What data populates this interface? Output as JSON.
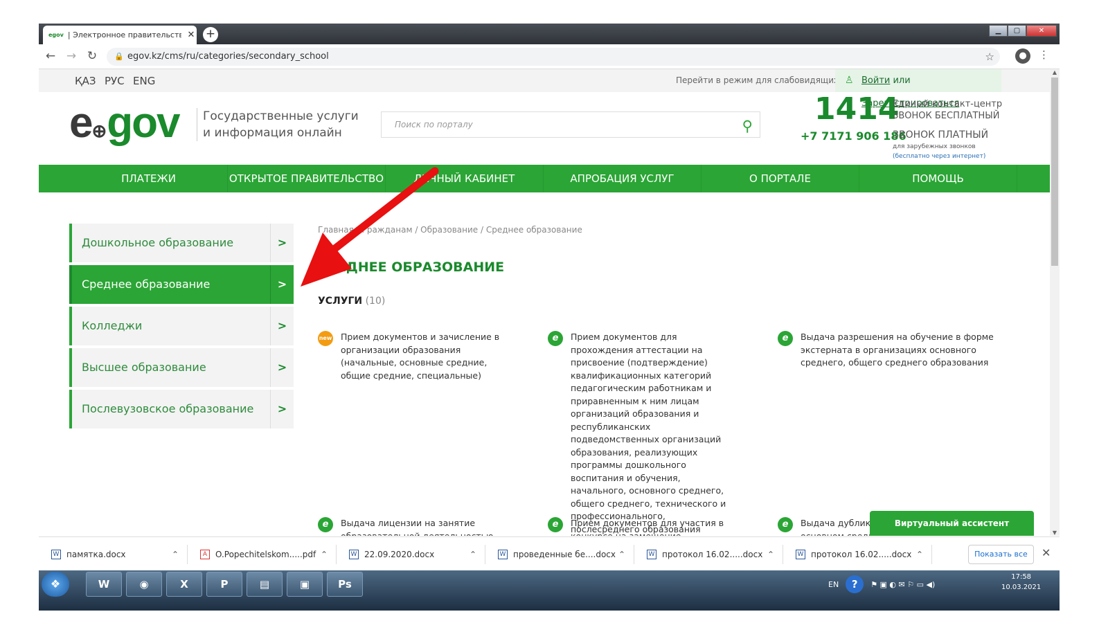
{
  "browser": {
    "tab": {
      "favicon": "egov",
      "title": "| Электронное правительство Р",
      "close": "✕"
    },
    "new_tab": "+",
    "url": "egov.kz/cms/ru/categories/secondary_school"
  },
  "top": {
    "languages": [
      "ҚАЗ",
      "РУС",
      "ENG"
    ],
    "impaired_mode": "Перейти в режим для слабовидящих",
    "login": {
      "login": "Войти",
      "or": " или ",
      "register": "Зарегистрироваться"
    }
  },
  "header": {
    "logo": {
      "e": "e",
      "dot": "⊕",
      "gov": "gov"
    },
    "slogan": [
      "Государственные услуги",
      "и информация онлайн"
    ],
    "search_placeholder": "Поиск по порталу",
    "contact": {
      "number": "1414",
      "center": "Единый контакт-центр",
      "free": "ЗВОНОК БЕСПЛАТНЫЙ",
      "phone": "+7 7171 906 186",
      "paid": "ЗВОНОК ПЛАТНЫЙ",
      "foreign": "для зарубежных звонков",
      "internet": "(бесплатно через интернет)"
    }
  },
  "menu": [
    "ПЛАТЕЖИ",
    "ОТКРЫТОЕ ПРАВИТЕЛЬСТВО",
    "ЛИЧНЫЙ КАБИНЕТ",
    "АПРОБАЦИЯ УСЛУГ",
    "О ПОРТАЛЕ",
    "ПОМОЩЬ"
  ],
  "sidebar": [
    {
      "label": "Дошкольное образование"
    },
    {
      "label": "Среднее образование"
    },
    {
      "label": "Колледжи"
    },
    {
      "label": "Высшее образование"
    },
    {
      "label": "Послевузовское образование"
    }
  ],
  "main": {
    "breadcrumb": "Главная / Гражданам / Образование / Среднее образование",
    "title": "СРЕДНЕЕ ОБРАЗОВАНИЕ",
    "services_label": "УСЛУГИ",
    "services_count": "(10)",
    "services": [
      {
        "icon": "new",
        "text": "Прием документов и зачисление в организации образования (начальные, основные средние, общие средние, специальные)"
      },
      {
        "icon": "e",
        "text": "Прием документов для прохождения аттестации на присвоение (подтверждение) квалификационных категорий педагогическим работникам и приравненным к ним лицам организаций образования и республиканских подведомственных организаций образования, реализующих программы дошкольного воспитания и обучения, начального, основного среднего, общего среднего, технического и профессионального, послесреднего образования"
      },
      {
        "icon": "e",
        "text": "Выдача разрешения на обучение в форме экстерната в организациях основного среднего, общего среднего образования"
      },
      {
        "icon": "e",
        "text": "Выдача лицензии на занятие образовательной деятельностью"
      },
      {
        "icon": "e",
        "text": "Прием документов для участия в конкурсе на замещение руководителей"
      },
      {
        "icon": "e",
        "text": "Выдача дубликатов документов об основном среднем, общем среднем образовании"
      }
    ],
    "assistant": "Виртуальный ассистент"
  },
  "downloads": {
    "files": [
      "памятка.docx",
      "O.Popechitelskom.....pdf",
      "22.09.2020.docx",
      "проведенные бе....docx",
      "протокол 16.02.....docx",
      "протокол 16.02.....docx"
    ],
    "show_all": "Показать все"
  },
  "taskbar": {
    "apps": [
      "W",
      "◉",
      "X",
      "P",
      "▤",
      "▣",
      "Ps"
    ],
    "lang": "EN",
    "time": "17:58",
    "date": "10.03.2021"
  }
}
